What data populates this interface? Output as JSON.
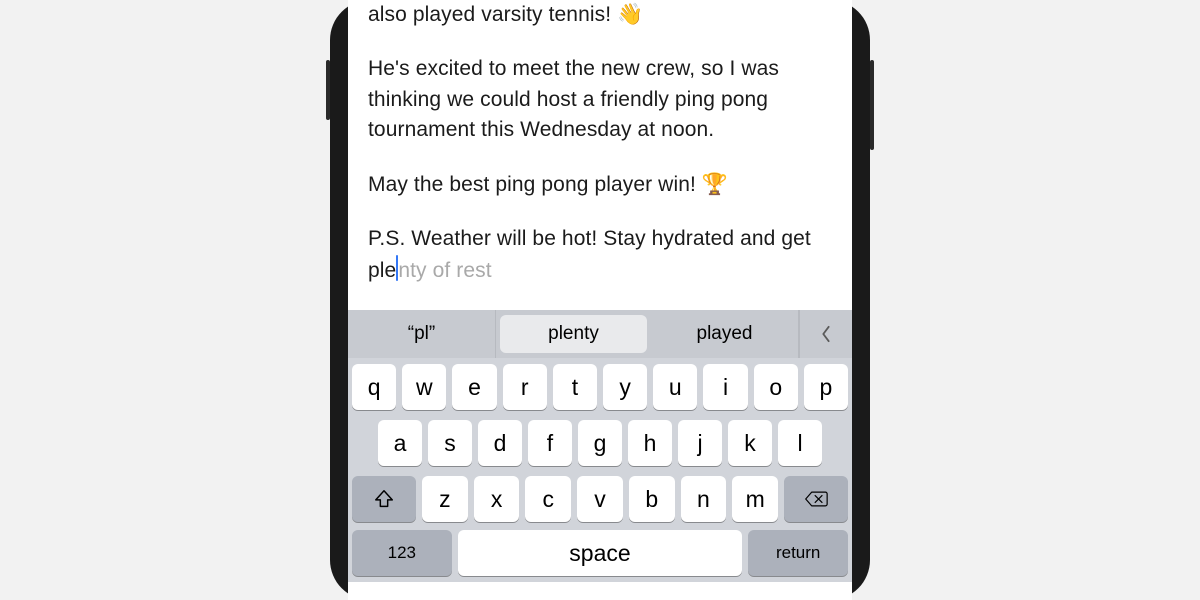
{
  "compose": {
    "line_top_partial": "also played varsity tennis! ",
    "emoji_wave": "👋",
    "paragraph2": "He's excited to meet the new crew, so I was thinking we could host a friendly ping pong tournament this Wednesday at noon.",
    "paragraph3": "May the best ping pong player win! ",
    "emoji_trophy": "🏆",
    "paragraph4_typed": "P.S. Weather will be hot! Stay hydrated and get ple",
    "inline_suggestion": "nty of rest"
  },
  "keyboard": {
    "predictions": [
      "“pl”",
      "plenty",
      "played"
    ],
    "rows": [
      [
        "q",
        "w",
        "e",
        "r",
        "t",
        "y",
        "u",
        "i",
        "o",
        "p"
      ],
      [
        "a",
        "s",
        "d",
        "f",
        "g",
        "h",
        "j",
        "k",
        "l"
      ],
      [
        "z",
        "x",
        "c",
        "v",
        "b",
        "n",
        "m"
      ]
    ],
    "bottom": {
      "numbers": "123",
      "space": "space",
      "return": "return"
    }
  }
}
